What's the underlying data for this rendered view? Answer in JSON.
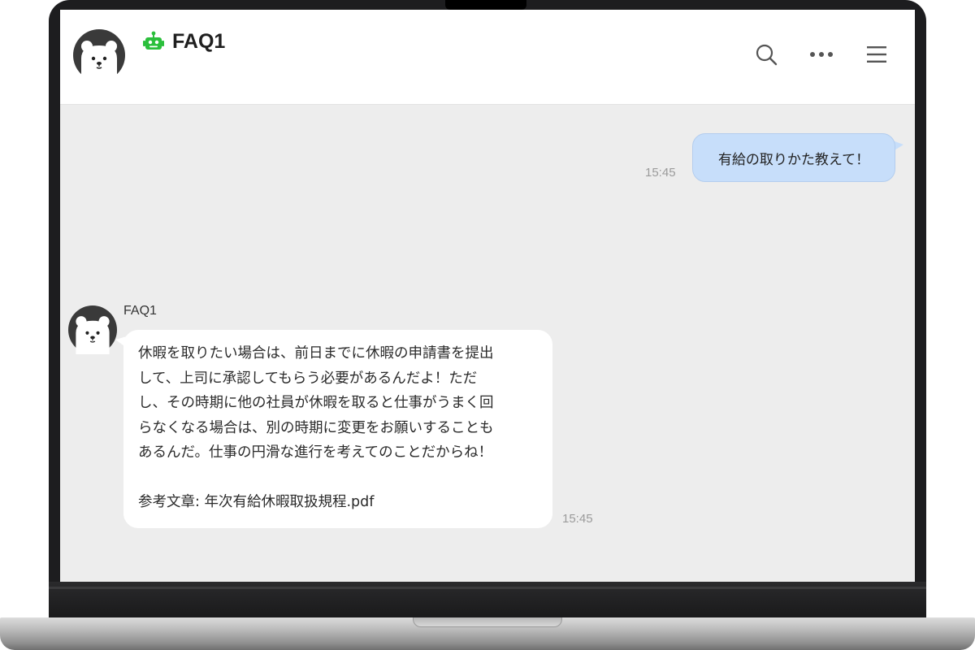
{
  "header": {
    "title": "FAQ1"
  },
  "conversation": {
    "user_message": {
      "text": "有給の取りかた教えて！",
      "time": "15:45"
    },
    "bot_message": {
      "sender": "FAQ1",
      "lines": [
        "休暇を取りたい場合は、前日までに休暇の申請書を提出",
        "して、上司に承認してもらう必要があるんだよ！ただ",
        "し、その時期に他の社員が休暇を取ると仕事がうまく回",
        "らなくなる場合は、別の時期に変更をお願いすることも",
        "あるんだ。仕事の円滑な進行を考えてのことだからね！"
      ],
      "reference": "参考文章: 年次有給休暇取扱規程.pdf",
      "time": "15:45"
    }
  },
  "colors": {
    "bot_icon": "#2bbf3c",
    "user_bubble": "#c7defa",
    "chat_background": "#ededed"
  },
  "icons": {
    "header_avatar": "polar-bear-avatar-icon",
    "bot_badge": "robot-icon",
    "search": "search-icon",
    "more": "more-dots-icon",
    "menu": "hamburger-menu-icon"
  }
}
